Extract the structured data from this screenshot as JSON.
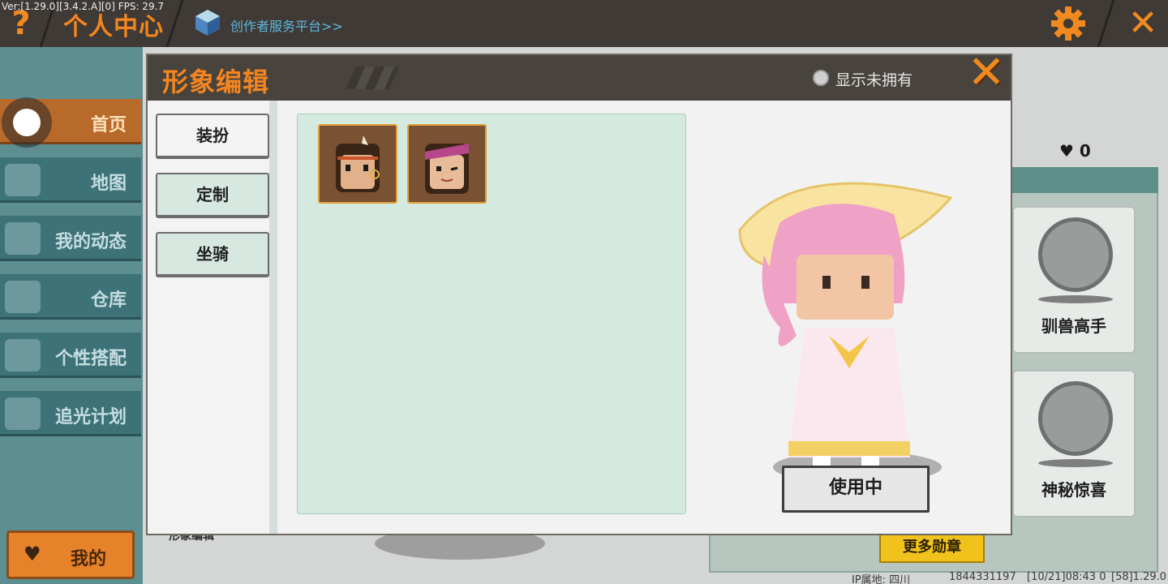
{
  "version_text": "Ver:[1.29.0][3.4.2.A][0] FPS: 29.7",
  "topbar": {
    "help_icon": "question-mark-icon",
    "title": "个人中心",
    "creator_link": "创作者服务平台>>",
    "settings_icon": "gear-icon",
    "close_icon": "close-icon",
    "accent": "#f4851f"
  },
  "sidebar": {
    "items": [
      {
        "label": "首页",
        "icon": "home-icon",
        "active": true
      },
      {
        "label": "地图",
        "icon": "map-icon"
      },
      {
        "label": "我的动态",
        "icon": "bell-icon"
      },
      {
        "label": "仓库",
        "icon": "warehouse-icon"
      },
      {
        "label": "个性搭配",
        "icon": "outfit-icon"
      },
      {
        "label": "追光计划",
        "icon": "plan-icon"
      }
    ],
    "my_button": "我的"
  },
  "background": {
    "likes": "0",
    "medals": [
      {
        "label": "驯兽高手",
        "icon": "tamer-medal-icon"
      },
      {
        "label": "神秘惊喜",
        "icon": "mystery-gift-medal-icon"
      }
    ],
    "more_medals": "更多勋章",
    "avatar_label": "形象编辑",
    "footer": {
      "ip": "IP属地: 四川",
      "uid": "1844331197",
      "time": "[10/21]08:43 0",
      "build": "[58]1.29.0"
    }
  },
  "modal": {
    "title": "形象编辑",
    "show_unowned": "显示未拥有",
    "tabs": [
      "装扮",
      "定制",
      "坐骑"
    ],
    "items": [
      {
        "name": "indian-girl-avatar"
      },
      {
        "name": "bandana-girl-avatar"
      }
    ],
    "use_button": "使用中"
  }
}
